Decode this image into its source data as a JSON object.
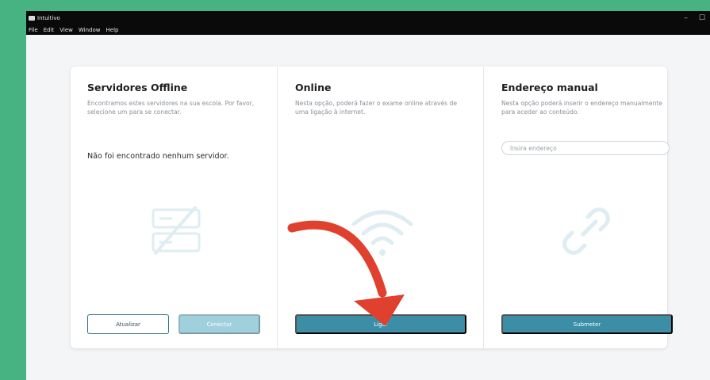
{
  "window": {
    "title": "Intuitivo",
    "minimize_glyph": "–",
    "maximize_glyph": "☐"
  },
  "menu": [
    "File",
    "Edit",
    "View",
    "Window",
    "Help"
  ],
  "offline": {
    "title": "Servidores Offline",
    "description": "Encontramos estes servidores na sua escola. Por favor, selecione um para se conectar.",
    "empty_message": "Não foi encontrado nenhum servidor.",
    "icon": "server-off-icon",
    "refresh_label": "Atualizar",
    "connect_label": "Conectar"
  },
  "online": {
    "title": "Online",
    "description": "Nesta opção, poderá fazer o exame online através de uma ligação à internet.",
    "icon": "wifi-icon",
    "connect_label": "Ligar"
  },
  "manual": {
    "title": "Endereço manual",
    "description": "Nesta opção poderá inserir o endereço manualmente para aceder ao conteúdo.",
    "address_placeholder": "Insira endereço",
    "address_value": "",
    "icon": "link-icon",
    "submit_label": "Submeter"
  },
  "colors": {
    "background": "#47b383",
    "primary": "#3b8ea6",
    "primary_disabled": "#9fd0dc",
    "illustration": "#dfecf1",
    "annotation_arrow": "#e0402e"
  }
}
